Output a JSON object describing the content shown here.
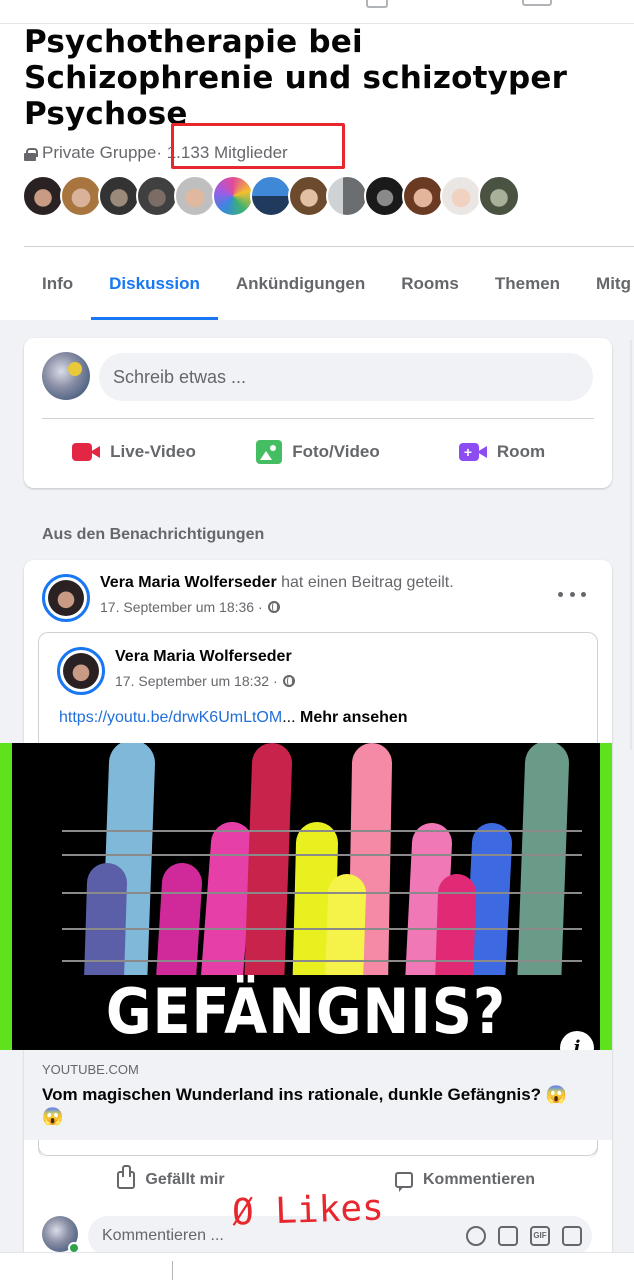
{
  "group": {
    "title": "Psychotherapie bei Schizophrenie und schizotyper Psychose",
    "privacy": "Private Gruppe",
    "members": "· 1.133 Mitglieder"
  },
  "tabs": [
    "Info",
    "Diskussion",
    "Ankündigungen",
    "Rooms",
    "Themen",
    "Mitg"
  ],
  "composer": {
    "placeholder": "Schreib etwas ...",
    "actions": [
      "Live-Video",
      "Foto/Video",
      "Room"
    ]
  },
  "section_heading": "Aus den Benachrichtigungen",
  "post": {
    "author": "Vera Maria Wolferseder",
    "action": " hat einen Beitrag geteilt.",
    "time": "17. September um 18:36 ·",
    "shared": {
      "author": "Vera Maria Wolferseder",
      "time": "17. September um 18:32 ·",
      "url": "https://youtu.be/drwK6UmLtOM",
      "ellipsis": "...",
      "more": " Mehr ansehen"
    },
    "thumbnail_text": "GEFÄNGNIS?",
    "link_domain": "YOUTUBE.COM",
    "link_title": "Vom magischen Wunderland ins rationale, dunkle Gefängnis? 😱😱",
    "like_label": "Gefällt mir",
    "comment_label": "Kommentieren",
    "comment_placeholder": "Kommentieren ..."
  },
  "annotation": "Ø Likes",
  "colors": {
    "accent": "#1877f2",
    "highlight": "#e8262d",
    "live": "#e42645",
    "photo": "#45bd62",
    "room": "#8c4cf2"
  }
}
